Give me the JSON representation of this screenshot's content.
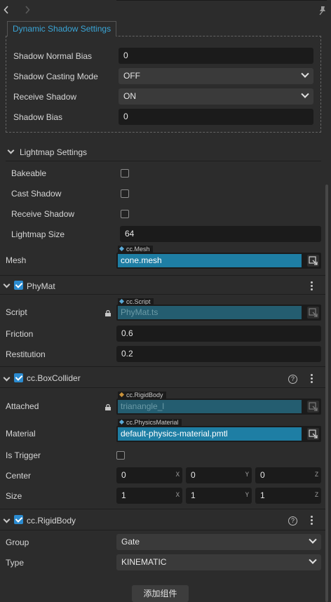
{
  "dynamic_shadow": {
    "tab_label": "Dynamic Shadow Settings",
    "rows": [
      {
        "label": "Shadow Normal Bias",
        "value": "0"
      },
      {
        "label": "Shadow Casting Mode",
        "value": "OFF"
      },
      {
        "label": "Receive Shadow",
        "value": "ON"
      },
      {
        "label": "Shadow Bias",
        "value": "0"
      }
    ]
  },
  "lightmap": {
    "title": "Lightmap Settings",
    "bakeable_label": "Bakeable",
    "cast_shadow_label": "Cast Shadow",
    "receive_shadow_label": "Receive Shadow",
    "lightmap_size_label": "Lightmap Size",
    "lightmap_size_value": "64"
  },
  "mesh": {
    "label": "Mesh",
    "type_tag": "cc.Mesh",
    "value": "cone.mesh"
  },
  "phymat": {
    "title": "PhyMat",
    "script_label": "Script",
    "script_tag": "cc.Script",
    "script_value": "PhyMat.ts",
    "friction_label": "Friction",
    "friction_value": "0.6",
    "restitution_label": "Restitution",
    "restitution_value": "0.2"
  },
  "box_collider": {
    "title": "cc.BoxCollider",
    "attached_label": "Attached",
    "attached_tag": "cc.RigidBody",
    "attached_value": "trianangle_l",
    "material_label": "Material",
    "material_tag": "cc.PhysicsMaterial",
    "material_value": "default-physics-material.pmtl",
    "is_trigger_label": "Is Trigger",
    "center_label": "Center",
    "center": {
      "x": "0",
      "y": "0",
      "z": "0"
    },
    "size_label": "Size",
    "size": {
      "x": "1",
      "y": "1",
      "z": "1"
    },
    "axis": {
      "x": "X",
      "y": "Y",
      "z": "Z"
    }
  },
  "rigid_body": {
    "title": "cc.RigidBody",
    "group_label": "Group",
    "group_value": "Gate",
    "type_label": "Type",
    "type_value": "KINEMATIC"
  },
  "help_glyph": "?",
  "add_component_label": "添加组件",
  "colors": {
    "accent": "#3aa5d6",
    "asset_fill": "#1e7ea4",
    "checkbox_on": "#2b8bd0",
    "script_diamond": "#5aa9d6",
    "rigidbody_diamond": "#c8913a"
  },
  "icons": [
    "back-arrow-icon",
    "forward-arrow-icon",
    "pin-icon",
    "lock-icon",
    "help-icon",
    "more-icon",
    "chevron-down-icon",
    "asset-picker-icon"
  ]
}
